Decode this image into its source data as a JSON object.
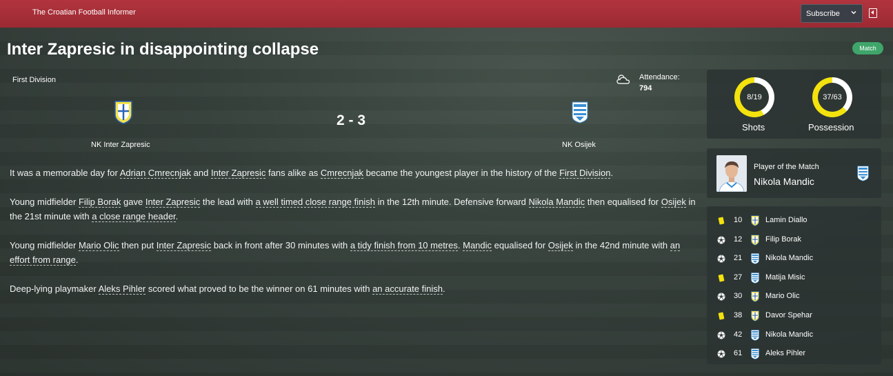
{
  "header": {
    "source": "The Croatian Football Informer",
    "subscribe_label": "Subscribe"
  },
  "article": {
    "headline": "Inter Zapresic in disappointing collapse",
    "tag": "Match"
  },
  "match": {
    "competition": "First Division",
    "attendance_label": "Attendance:",
    "attendance_value": "794",
    "score": "2 - 3",
    "home_team": "NK Inter Zapresic",
    "away_team": "NK Osijek"
  },
  "report": {
    "p1": {
      "s1": "It was a memorable day for ",
      "l1": "Adrian Cmrecnjak",
      "s2": " and ",
      "l2": "Inter Zapresic",
      "s3": " fans alike as ",
      "l3": "Cmrecnjak",
      "s4": " became the youngest player in the history of the ",
      "l4": "First Division",
      "s5": "."
    },
    "p2": {
      "s1": "Young midfielder ",
      "l1": "Filip Borak",
      "s2": " gave ",
      "l2": "Inter Zapresic",
      "s3": " the lead with ",
      "l3": "a well timed close range finish",
      "s4": " in the 12th minute. Defensive forward ",
      "l4": "Nikola Mandic",
      "s5": " then equalised for ",
      "l5": "Osijek",
      "s6": " in the 21st minute with ",
      "l6": "a close range header",
      "s7": "."
    },
    "p3": {
      "s1": "Young midfielder ",
      "l1": "Mario Olic",
      "s2": " then put ",
      "l2": "Inter Zapresic",
      "s3": " back in front after 30 minutes with ",
      "l3": "a tidy finish from 10 metres",
      "s4": ". ",
      "l4": "Mandic",
      "s5": " equalised for ",
      "l5": "Osijek",
      "s6": " in the 42nd minute with ",
      "l6": "an effort from range",
      "s7": "."
    },
    "p4": {
      "s1": "Deep-lying playmaker ",
      "l1": "Aleks Pihler",
      "s2": " scored what proved to be the winner on 61 minutes with ",
      "l2": "an accurate finish",
      "s3": "."
    }
  },
  "stats": {
    "shots_value": "8/19",
    "shots_label": "Shots",
    "shots_home_fraction": 0.42,
    "possession_value": "37/63",
    "possession_label": "Possession",
    "possession_home_fraction": 0.37
  },
  "potm": {
    "label": "Player of the Match",
    "name": "Nikola Mandic"
  },
  "events": [
    {
      "type": "yellow-card",
      "minute": "10",
      "team": "home",
      "player": "Lamin Diallo"
    },
    {
      "type": "goal",
      "minute": "12",
      "team": "home",
      "player": "Filip Borak"
    },
    {
      "type": "goal",
      "minute": "21",
      "team": "away",
      "player": "Nikola Mandic"
    },
    {
      "type": "yellow-card",
      "minute": "27",
      "team": "away",
      "player": "Matija Misic"
    },
    {
      "type": "goal",
      "minute": "30",
      "team": "home",
      "player": "Mario Olic"
    },
    {
      "type": "yellow-card",
      "minute": "38",
      "team": "home",
      "player": "Davor Spehar"
    },
    {
      "type": "goal",
      "minute": "42",
      "team": "away",
      "player": "Nikola Mandic"
    },
    {
      "type": "goal",
      "minute": "61",
      "team": "away",
      "player": "Aleks Pihler"
    }
  ],
  "colors": {
    "topbar": "#b1343e",
    "accent_yellow": "#f3e20e",
    "tag_green": "#3fa56a"
  }
}
